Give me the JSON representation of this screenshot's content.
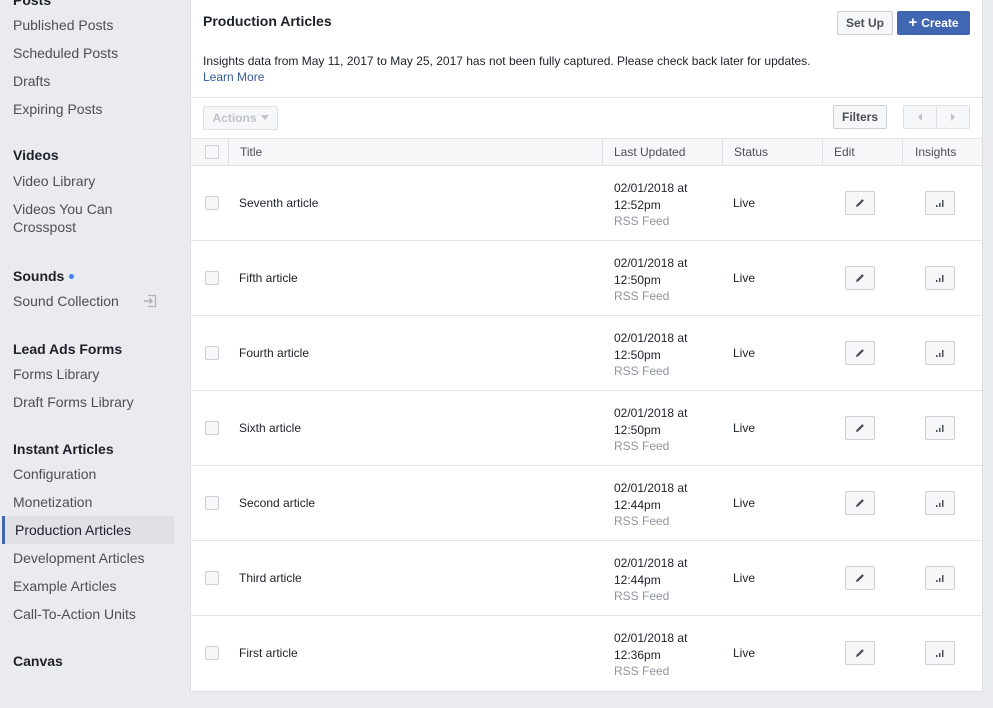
{
  "sidebar": {
    "sections": [
      {
        "heading": "Posts",
        "items": [
          {
            "label": "Published Posts"
          },
          {
            "label": "Scheduled Posts"
          },
          {
            "label": "Drafts"
          },
          {
            "label": "Expiring Posts"
          }
        ]
      },
      {
        "heading": "Videos",
        "items": [
          {
            "label": "Video Library"
          },
          {
            "label": "Videos You Can Crosspost"
          }
        ]
      },
      {
        "heading": "Sounds",
        "items": [
          {
            "label": "Sound Collection"
          }
        ]
      },
      {
        "heading": "Lead Ads Forms",
        "items": [
          {
            "label": "Forms Library"
          },
          {
            "label": "Draft Forms Library"
          }
        ]
      },
      {
        "heading": "Instant Articles",
        "items": [
          {
            "label": "Configuration"
          },
          {
            "label": "Monetization"
          },
          {
            "label": "Production Articles",
            "active": true
          },
          {
            "label": "Development Articles"
          },
          {
            "label": "Example Articles"
          },
          {
            "label": "Call-To-Action Units"
          }
        ]
      },
      {
        "heading": "Canvas",
        "items": []
      }
    ]
  },
  "main": {
    "title": "Production Articles",
    "setup_label": "Set Up",
    "create_label": "Create",
    "create_icon": "+",
    "notice": "Insights data from May 11, 2017 to May 25, 2017 has not been fully captured. Please check back later for updates.",
    "learn_more": "Learn More",
    "actions_label": "Actions",
    "filters_label": "Filters",
    "accent_color": "#4267b2"
  },
  "table": {
    "columns": {
      "title": "Title",
      "last_updated": "Last Updated",
      "status": "Status",
      "edit": "Edit",
      "insights": "Insights"
    },
    "rows": [
      {
        "title": "Seventh article",
        "date": "02/01/2018 at",
        "time": "12:52pm",
        "source": "RSS Feed",
        "status": "Live"
      },
      {
        "title": "Fifth article",
        "date": "02/01/2018 at",
        "time": "12:50pm",
        "source": "RSS Feed",
        "status": "Live"
      },
      {
        "title": "Fourth article",
        "date": "02/01/2018 at",
        "time": "12:50pm",
        "source": "RSS Feed",
        "status": "Live"
      },
      {
        "title": "Sixth article",
        "date": "02/01/2018 at",
        "time": "12:50pm",
        "source": "RSS Feed",
        "status": "Live"
      },
      {
        "title": "Second article",
        "date": "02/01/2018 at",
        "time": "12:44pm",
        "source": "RSS Feed",
        "status": "Live"
      },
      {
        "title": "Third article",
        "date": "02/01/2018 at",
        "time": "12:44pm",
        "source": "RSS Feed",
        "status": "Live"
      },
      {
        "title": "First article",
        "date": "02/01/2018 at",
        "time": "12:36pm",
        "source": "RSS Feed",
        "status": "Live"
      }
    ]
  }
}
